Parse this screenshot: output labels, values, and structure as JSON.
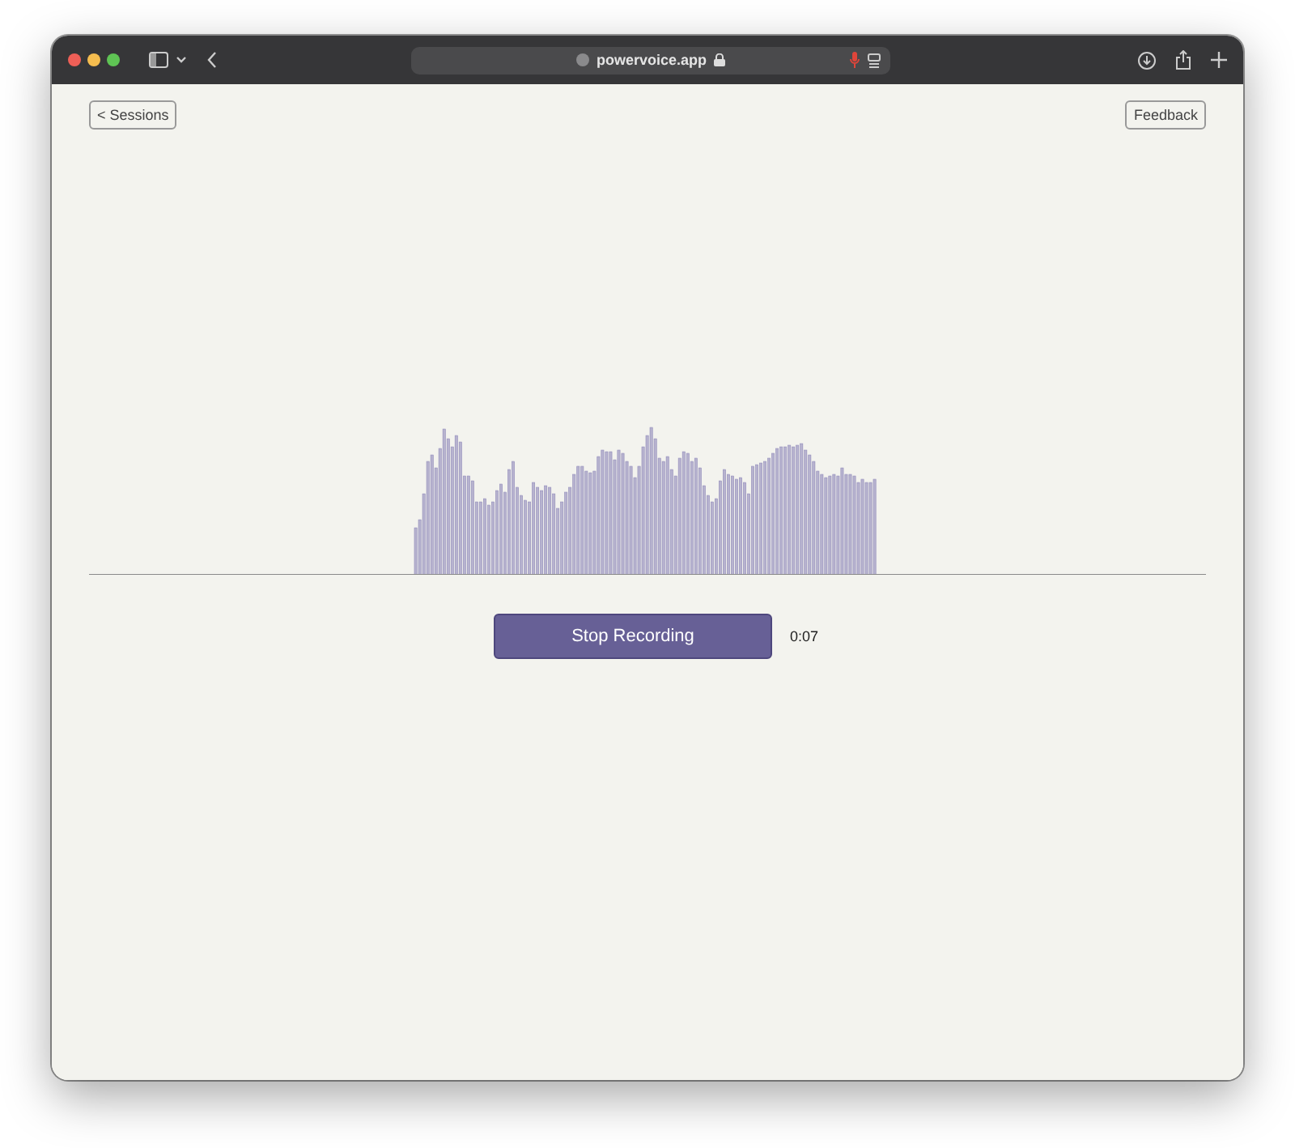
{
  "browser": {
    "url": "powervoice.app"
  },
  "header": {
    "back_button": "< Sessions",
    "feedback_button": "Feedback"
  },
  "recorder": {
    "stop_button": "Stop Recording",
    "elapsed": "0:07"
  }
}
